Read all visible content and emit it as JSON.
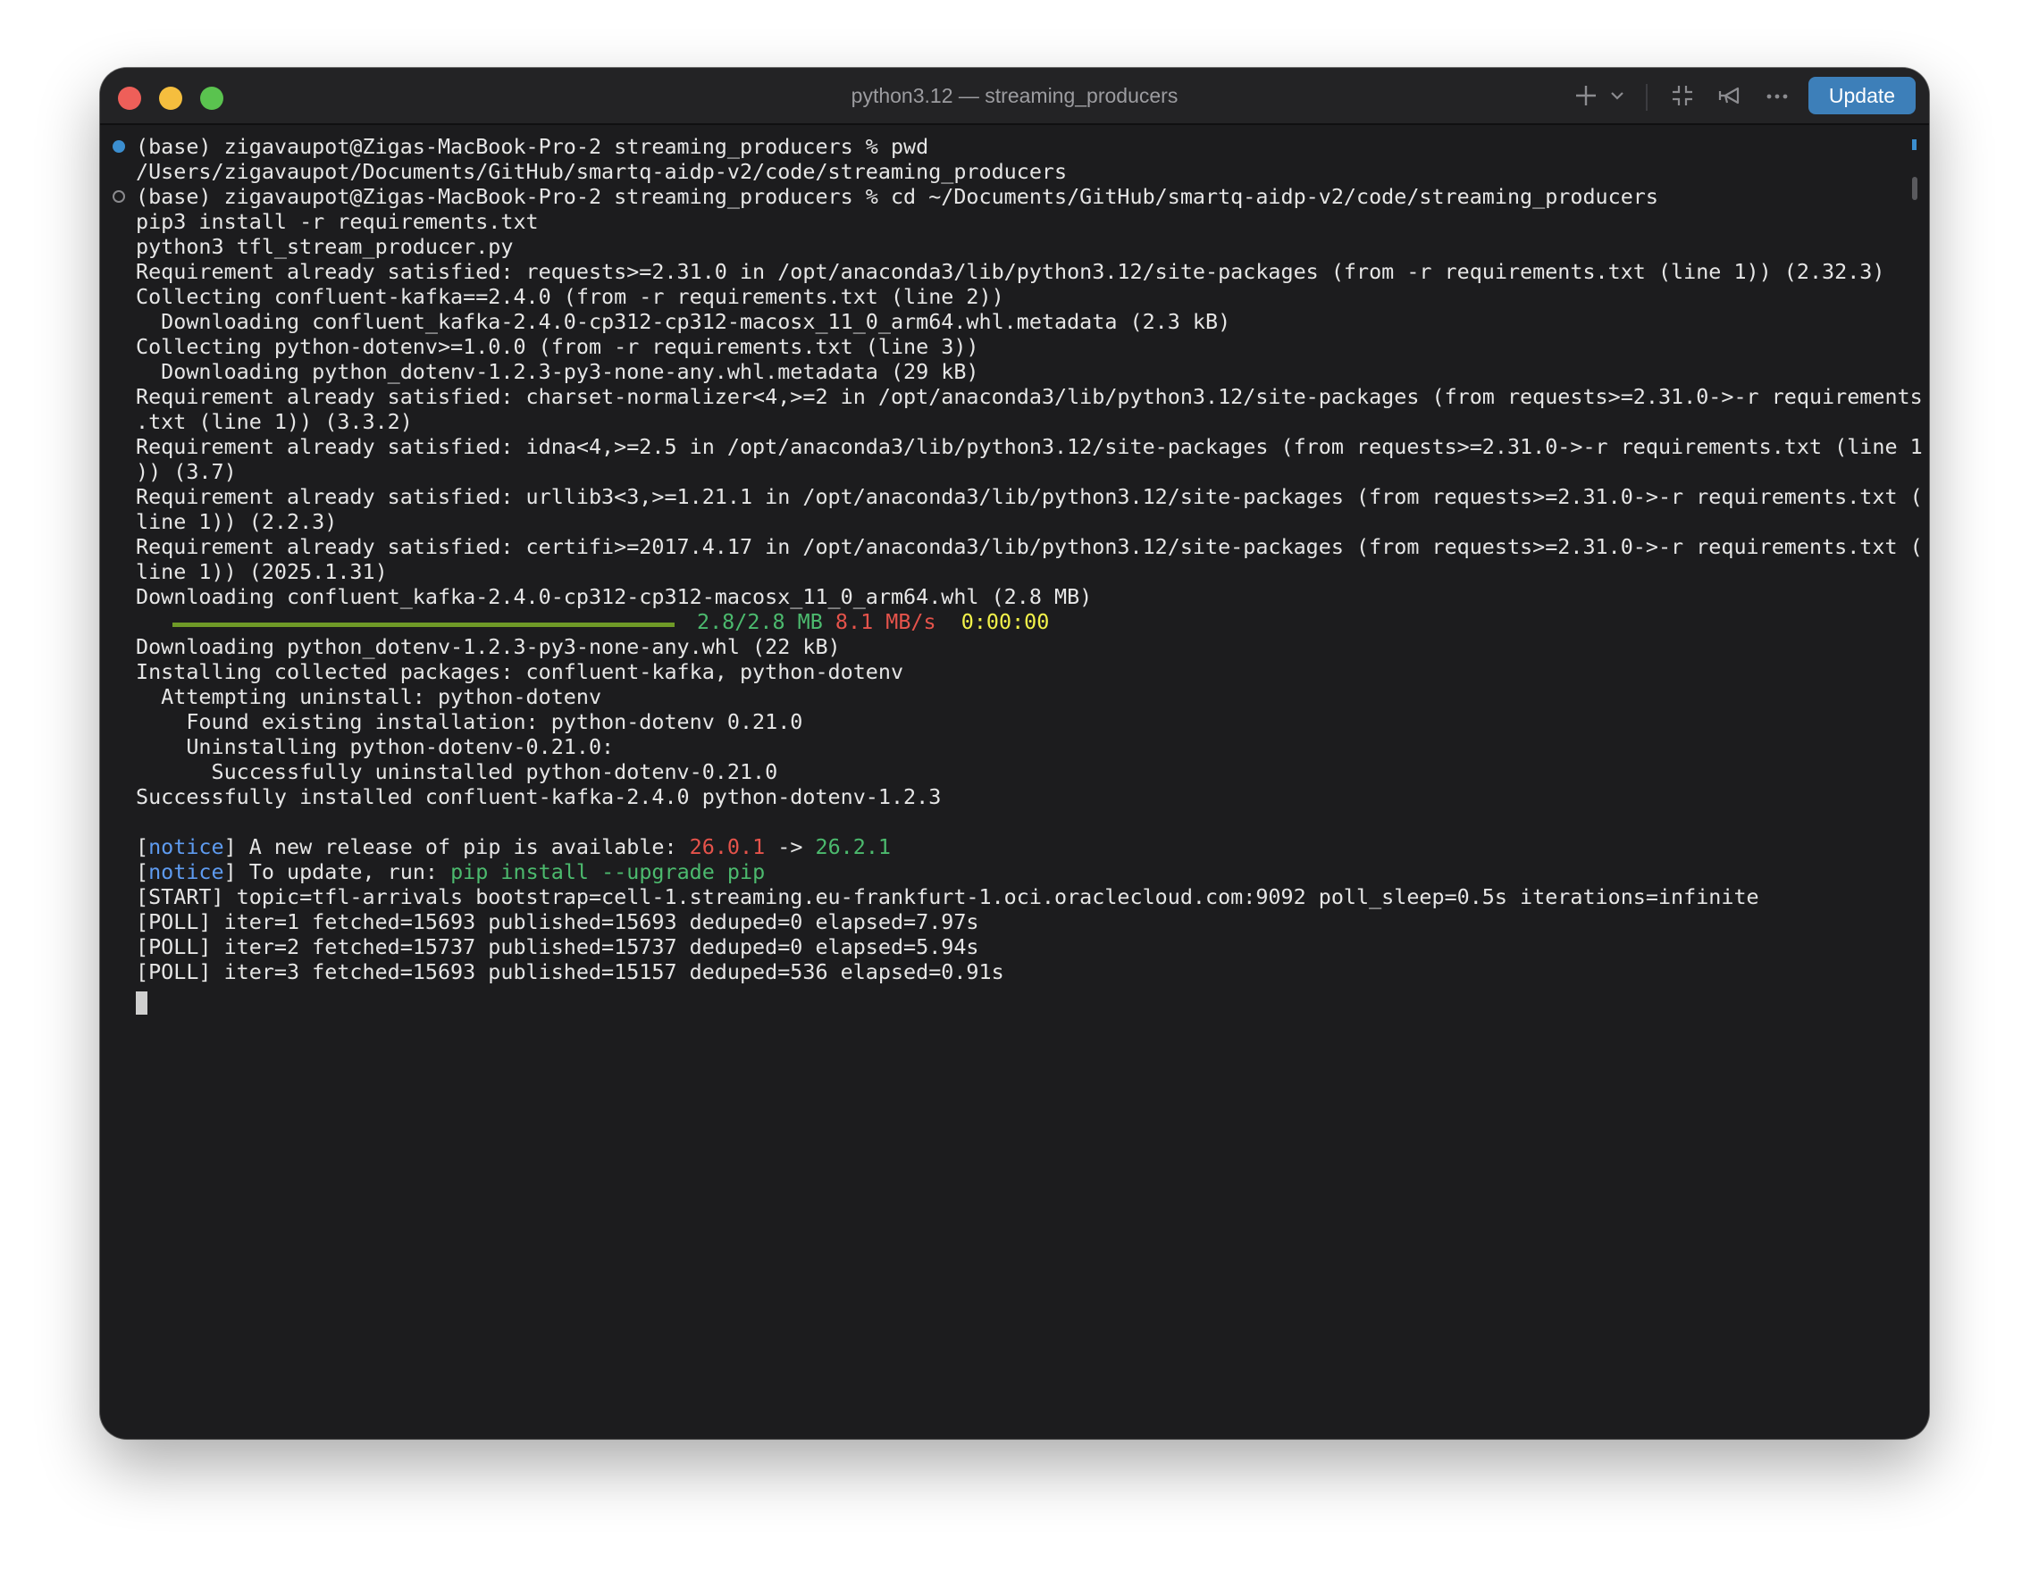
{
  "window": {
    "title": "python3.12 — streaming_producers",
    "update_label": "Update",
    "icons": {
      "new_tab": "plus-icon",
      "dropdown": "chevron-down-icon",
      "fullscreen": "collapse-icon",
      "broadcast": "broadcast-icon",
      "more": "ellipsis-icon"
    },
    "colors": {
      "close": "#ee5f59",
      "minimize": "#f5be3e",
      "zoom": "#5ac34f",
      "update_button": "#3d7fb9"
    }
  },
  "terminal": {
    "lines": [
      "(base) zigavaupot@Zigas-MacBook-Pro-2 streaming_producers % pwd",
      "/Users/zigavaupot/Documents/GitHub/smartq-aidp-v2/code/streaming_producers",
      "(base) zigavaupot@Zigas-MacBook-Pro-2 streaming_producers % cd ~/Documents/GitHub/smartq-aidp-v2/code/streaming_producers",
      "pip3 install -r requirements.txt",
      "python3 tfl_stream_producer.py",
      "Requirement already satisfied: requests>=2.31.0 in /opt/anaconda3/lib/python3.12/site-packages (from -r requirements.txt (line 1)) (2.32.3)",
      "Collecting confluent-kafka==2.4.0 (from -r requirements.txt (line 2))",
      "  Downloading confluent_kafka-2.4.0-cp312-cp312-macosx_11_0_arm64.whl.metadata (2.3 kB)",
      "Collecting python-dotenv>=1.0.0 (from -r requirements.txt (line 3))",
      "  Downloading python_dotenv-1.2.3-py3-none-any.whl.metadata (29 kB)",
      "Requirement already satisfied: charset-normalizer<4,>=2 in /opt/anaconda3/lib/python3.12/site-packages (from requests>=2.31.0->-r requirements",
      ".txt (line 1)) (3.3.2)",
      "Requirement already satisfied: idna<4,>=2.5 in /opt/anaconda3/lib/python3.12/site-packages (from requests>=2.31.0->-r requirements.txt (line 1",
      ")) (3.7)",
      "Requirement already satisfied: urllib3<3,>=1.21.1 in /opt/anaconda3/lib/python3.12/site-packages (from requests>=2.31.0->-r requirements.txt (",
      "line 1)) (2.2.3)",
      "Requirement already satisfied: certifi>=2017.4.17 in /opt/anaconda3/lib/python3.12/site-packages (from requests>=2.31.0->-r requirements.txt (",
      "line 1)) (2025.1.31)",
      "Downloading confluent_kafka-2.4.0-cp312-cp312-macosx_11_0_arm64.whl (2.8 MB)"
    ],
    "progress": {
      "fraction": 1.0,
      "size": "2.8/2.8 MB",
      "speed": "8.1 MB/s",
      "eta": "0:00:00"
    },
    "lines_after": [
      "Downloading python_dotenv-1.2.3-py3-none-any.whl (22 kB)",
      "Installing collected packages: confluent-kafka, python-dotenv",
      "  Attempting uninstall: python-dotenv",
      "    Found existing installation: python-dotenv 0.21.0",
      "    Uninstalling python-dotenv-0.21.0:",
      "      Successfully uninstalled python-dotenv-0.21.0",
      "Successfully installed confluent-kafka-2.4.0 python-dotenv-1.2.3"
    ],
    "notice1": {
      "open": "[",
      "tag": "notice",
      "close": "]",
      "text": " A new release of pip is available: ",
      "old_version": "26.0.1",
      "arrow": " -> ",
      "new_version": "26.2.1"
    },
    "notice2": {
      "open": "[",
      "tag": "notice",
      "close": "]",
      "text": " To update, run: ",
      "command": "pip install --upgrade pip"
    },
    "output_lines": [
      "[START] topic=tfl-arrivals bootstrap=cell-1.streaming.eu-frankfurt-1.oci.oraclecloud.com:9092 poll_sleep=0.5s iterations=infinite",
      "[POLL] iter=1 fetched=15693 published=15693 deduped=0 elapsed=7.97s",
      "[POLL] iter=2 fetched=15737 published=15737 deduped=0 elapsed=5.94s",
      "[POLL] iter=3 fetched=15693 published=15157 deduped=536 elapsed=0.91s"
    ]
  }
}
